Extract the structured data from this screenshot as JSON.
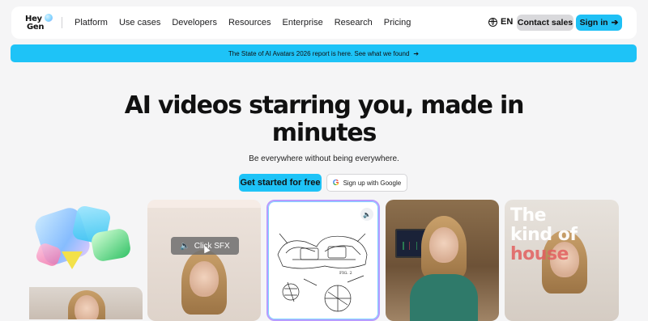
{
  "header": {
    "logo": {
      "line1": "Hey",
      "line2": "Gen"
    },
    "nav": [
      "Platform",
      "Use cases",
      "Developers",
      "Resources",
      "Enterprise",
      "Research",
      "Pricing"
    ],
    "language": "EN",
    "contact_label": "Contact sales",
    "signin_label": "Sign in",
    "signin_arrow": "➔"
  },
  "banner": {
    "text": "The State of AI Avatars 2026 report is here. See what we found",
    "arrow": "➔"
  },
  "hero": {
    "title_line1": "AI videos starring you, made in",
    "title_line2": "minutes",
    "subtitle": "Be everywhere without being everywhere.",
    "cta_primary": "Get started for free",
    "cta_google": "Sign up with Google",
    "google_glyph": "G"
  },
  "cards": {
    "sfx_button": "Click SFX",
    "sfx_icon": "🔈",
    "patent_fig": "FIG. 2",
    "speaker_icon": "🔈",
    "kind_words": [
      "The",
      "kind of",
      "house"
    ]
  },
  "colors": {
    "accent": "#1ec3f7",
    "header_bg": "#ffffff",
    "page_bg": "#f5f5f6"
  }
}
